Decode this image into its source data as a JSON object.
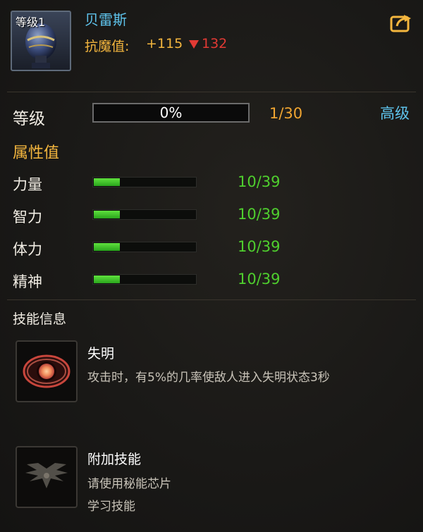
{
  "hero": {
    "level_badge": "等级1",
    "name": "贝雷斯",
    "resistance_label": "抗魔值:",
    "resistance_plus": "+115",
    "resistance_minus": "132"
  },
  "level": {
    "label": "等级",
    "progress_percent_text": "0%",
    "progress": 0,
    "value": "1/30",
    "advanced_link": "高级"
  },
  "attributes": {
    "title": "属性值",
    "items": [
      {
        "label": "力量",
        "value": "10/39",
        "fill": 0.256
      },
      {
        "label": "智力",
        "value": "10/39",
        "fill": 0.256
      },
      {
        "label": "体力",
        "value": "10/39",
        "fill": 0.256
      },
      {
        "label": "精神",
        "value": "10/39",
        "fill": 0.256
      }
    ]
  },
  "skills": {
    "title": "技能信息",
    "items": [
      {
        "icon": "blind-eye-icon",
        "name": "失明",
        "desc": [
          "攻击时，有5%的几率使敌人进入失明状态3秒"
        ]
      },
      {
        "icon": "winged-emblem-icon",
        "name": "附加技能",
        "desc": [
          "请使用秘能芯片",
          "学习技能"
        ]
      }
    ]
  },
  "colors": {
    "name": "#5ec3ec",
    "gold": "#f4b63e",
    "red": "#e23a34",
    "green": "#4fcf2e",
    "link": "#5ec3ec"
  }
}
